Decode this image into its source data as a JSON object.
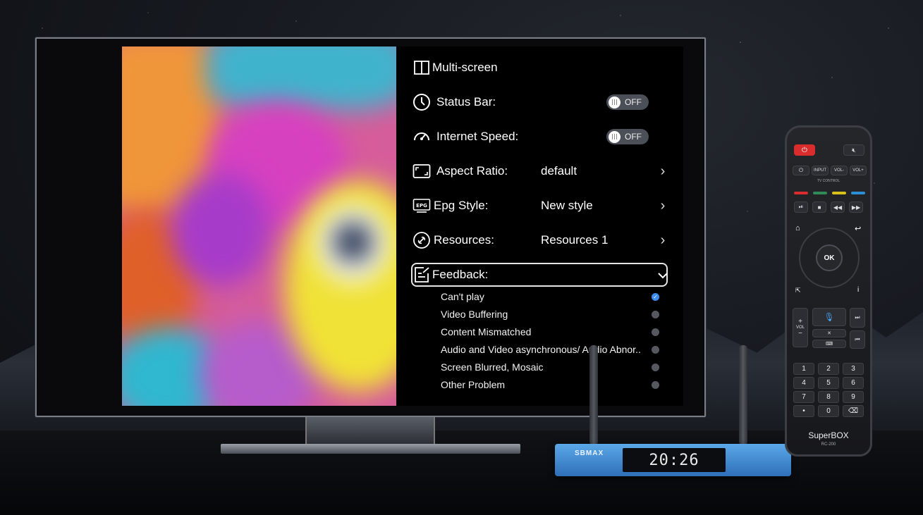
{
  "menu": {
    "multi_screen": "Multi-screen",
    "status_bar": {
      "label": "Status Bar:",
      "state": "OFF"
    },
    "internet_speed": {
      "label": "Internet Speed:",
      "state": "OFF"
    },
    "aspect_ratio": {
      "label": "Aspect Ratio:",
      "value": "default"
    },
    "epg_style": {
      "label": "Epg Style:",
      "value": "New style"
    },
    "resources": {
      "label": "Resources:",
      "value": "Resources 1"
    },
    "feedback": {
      "label": "Feedback:",
      "options": [
        {
          "label": "Can't play",
          "selected": true
        },
        {
          "label": "Video Buffering",
          "selected": false
        },
        {
          "label": "Content Mismatched",
          "selected": false
        },
        {
          "label": "Audio and Video asynchronous/ Audio Abnor..",
          "selected": false
        },
        {
          "label": "Screen Blurred, Mosaic",
          "selected": false
        },
        {
          "label": "Other Problem",
          "selected": false
        }
      ]
    }
  },
  "device": {
    "brand": "SBMAX",
    "display_time": "20:26"
  },
  "remote": {
    "input": "INPUT",
    "vol_minus": "VOL-",
    "vol_plus": "VOL+",
    "tv_control": "TV CONTROL",
    "ok": "OK",
    "vol": "VOL",
    "keys": [
      "1",
      "2",
      "3",
      "4",
      "5",
      "6",
      "7",
      "8",
      "9",
      "•",
      "0",
      "⌫"
    ],
    "logo": "SuperBOX",
    "model": "RC-200"
  },
  "colors": {
    "accent": "#3b8cf0",
    "remote_red": "#d92c2c",
    "remote_green": "#2e8b57",
    "remote_yellow": "#d8c21a",
    "remote_blue": "#2b8fd6"
  }
}
